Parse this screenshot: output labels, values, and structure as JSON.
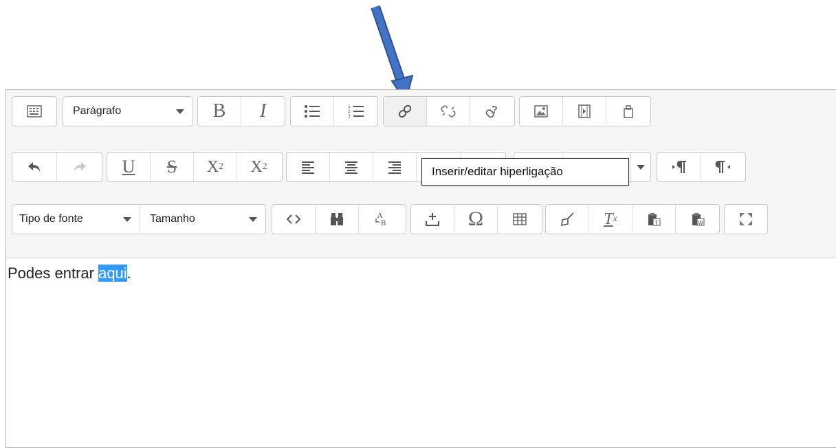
{
  "toolbar": {
    "row1": {
      "format_select": "Parágrafo",
      "bold": "B",
      "italic": "I"
    },
    "row2": {
      "underline": "U",
      "strike": "S",
      "subscript": "X",
      "subscript_mark": "2",
      "superscript": "X",
      "superscript_mark": "2"
    },
    "row3": {
      "font_family_select": "Tipo de fonte",
      "font_size_select": "Tamanho",
      "omega": "Ω",
      "clear_format": "T",
      "clear_format_mark": "x"
    }
  },
  "tooltip": {
    "text": "Inserir/editar hiperligação"
  },
  "content": {
    "text_before": "Podes entrar ",
    "selected_text": "aqui",
    "text_after": "."
  },
  "colors": {
    "annotation_arrow": "#4472c4",
    "selection": "#3399ff"
  }
}
